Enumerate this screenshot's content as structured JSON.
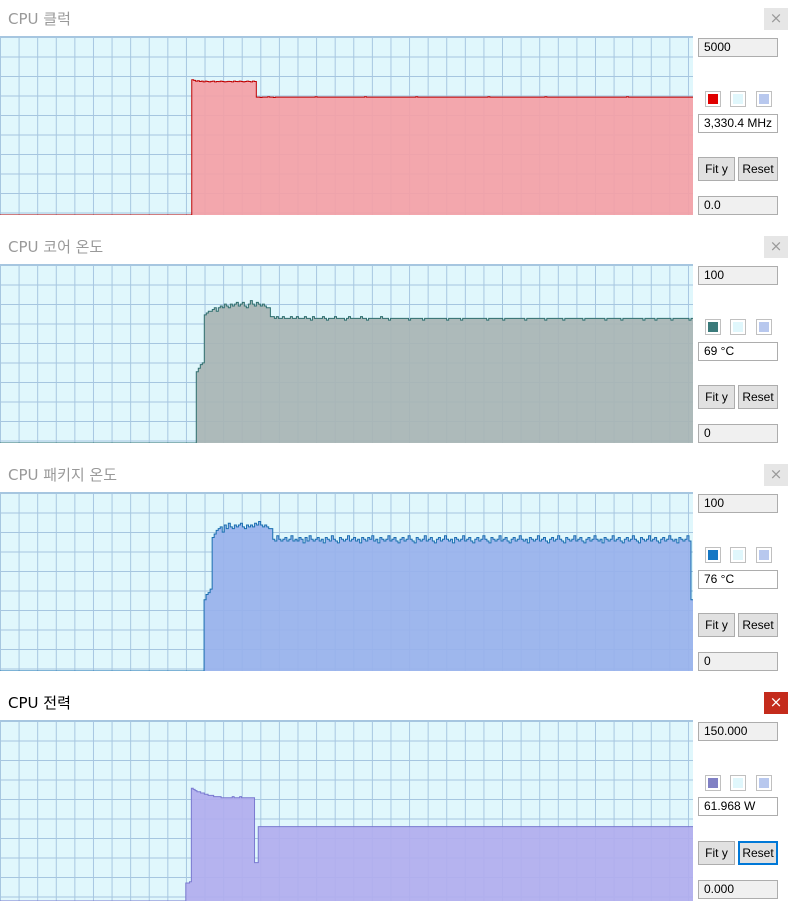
{
  "panels": [
    {
      "id": "cpu-clock",
      "title": "CPU 클럭",
      "active": false,
      "close_label": "×",
      "max": "5000",
      "current": "3,330.4 MHz",
      "min": "0.0",
      "fit_label": "Fit y",
      "reset_label": "Reset",
      "colors": {
        "line": "#c00000",
        "fill": "#f4a0a6",
        "swatch": "#e00000",
        "swatch3": "#b8c8ee"
      },
      "y_max": 5000,
      "series": [
        0,
        0,
        0,
        0,
        0,
        0,
        0,
        0,
        0,
        0,
        0,
        0,
        0,
        0,
        0,
        0,
        0,
        0,
        0,
        0,
        0,
        0,
        0,
        0,
        0,
        0,
        0,
        0,
        0,
        0,
        0,
        0,
        0,
        0,
        0,
        0,
        0,
        0,
        0,
        0,
        0,
        0,
        0,
        0,
        0,
        0,
        0,
        0,
        0,
        0,
        0,
        0,
        0,
        0,
        0,
        0,
        0,
        0,
        0,
        0,
        0,
        0,
        0,
        0,
        0,
        0,
        0,
        0,
        0,
        0,
        0,
        0,
        0,
        0,
        0,
        0,
        0,
        0,
        0,
        0,
        0,
        0,
        0,
        0,
        0,
        0,
        0,
        0,
        0,
        0,
        0,
        0,
        0,
        0,
        0,
        0,
        0,
        0,
        0,
        0,
        0,
        3800,
        3780,
        3760,
        3770,
        3750,
        3760,
        3740,
        3760,
        3750,
        3740,
        3755,
        3760,
        3740,
        3750,
        3745,
        3760,
        3750,
        3740,
        3745,
        3755,
        3750,
        3740,
        3760,
        3750,
        3745,
        3760,
        3750,
        3740,
        3750,
        3760,
        3750,
        3740,
        3760,
        3750,
        3310,
        3310,
        3300,
        3310,
        3310,
        3310,
        3320,
        3310,
        3310,
        3300,
        3310,
        3310,
        3310,
        3310,
        3310,
        3310,
        3310,
        3310,
        3310,
        3310,
        3310,
        3310,
        3310,
        3310,
        3310,
        3310,
        3310,
        3310,
        3310,
        3310,
        3310,
        3320,
        3310,
        3310,
        3310,
        3310,
        3310,
        3310,
        3310,
        3310,
        3310,
        3310,
        3310,
        3310,
        3310,
        3310,
        3310,
        3310,
        3310,
        3310,
        3310,
        3310,
        3310,
        3310,
        3310,
        3310,
        3310,
        3320,
        3310,
        3310,
        3310,
        3310,
        3310,
        3310,
        3310,
        3310,
        3310,
        3310,
        3310,
        3310,
        3310,
        3310,
        3310,
        3310,
        3310,
        3310,
        3310,
        3310,
        3310,
        3310,
        3310,
        3310,
        3310,
        3310,
        3320,
        3310,
        3310,
        3310,
        3310,
        3310,
        3310,
        3310,
        3310,
        3310,
        3310,
        3310,
        3310,
        3310,
        3310,
        3310,
        3310,
        3310,
        3310,
        3310,
        3310,
        3310,
        3310,
        3310,
        3310,
        3310,
        3310,
        3310,
        3310,
        3310,
        3310,
        3310,
        3310,
        3310,
        3310,
        3310,
        3310,
        3310,
        3320,
        3310,
        3310,
        3310,
        3310,
        3310,
        3310,
        3310,
        3310,
        3310,
        3310,
        3310,
        3310,
        3310,
        3310,
        3310,
        3310,
        3310,
        3310,
        3310,
        3310,
        3310,
        3310,
        3310,
        3310,
        3310,
        3310,
        3310,
        3310,
        3310,
        3320,
        3310,
        3310,
        3310,
        3310,
        3310,
        3310,
        3310,
        3310,
        3310,
        3310,
        3310,
        3310,
        3310,
        3310,
        3310,
        3310,
        3310,
        3310,
        3310,
        3310,
        3310,
        3310,
        3310,
        3310,
        3310,
        3310,
        3310,
        3310,
        3310,
        3310,
        3310,
        3310,
        3310,
        3310,
        3310,
        3310,
        3310,
        3310,
        3310,
        3310,
        3310,
        3310,
        3320,
        3310,
        3310,
        3310,
        3310,
        3310,
        3310,
        3310,
        3310,
        3310,
        3310,
        3310,
        3310,
        3310,
        3310,
        3310,
        3310,
        3310,
        3310,
        3310,
        3310,
        3310,
        3310,
        3310,
        3310,
        3310,
        3310,
        3310,
        3310,
        3310,
        3310,
        3310,
        3310,
        3310,
        3310
      ]
    },
    {
      "id": "cpu-core-temp",
      "title": "CPU 코어 온도",
      "active": false,
      "close_label": "×",
      "max": "100",
      "current": "69 °C",
      "min": "0",
      "fit_label": "Fit y",
      "reset_label": "Reset",
      "colors": {
        "line": "#2f6f6f",
        "fill": "#a8b4b4",
        "swatch": "#3a7a7a",
        "swatch3": "#b8c8ee"
      },
      "y_max": 100,
      "series": [
        0,
        0,
        0,
        0,
        0,
        0,
        0,
        0,
        0,
        0,
        0,
        0,
        0,
        0,
        0,
        0,
        0,
        0,
        0,
        0,
        0,
        0,
        0,
        0,
        0,
        0,
        0,
        0,
        0,
        0,
        0,
        0,
        0,
        0,
        0,
        0,
        0,
        0,
        0,
        0,
        0,
        0,
        0,
        0,
        0,
        0,
        0,
        0,
        0,
        0,
        0,
        0,
        0,
        0,
        0,
        0,
        0,
        0,
        0,
        0,
        0,
        0,
        0,
        0,
        0,
        0,
        0,
        0,
        0,
        0,
        0,
        0,
        0,
        0,
        0,
        0,
        0,
        0,
        0,
        0,
        0,
        0,
        0,
        0,
        0,
        0,
        0,
        0,
        0,
        0,
        0,
        0,
        0,
        0,
        0,
        0,
        0,
        0,
        40,
        42,
        44,
        45,
        72,
        73,
        74,
        74,
        75,
        76,
        74,
        76,
        77,
        76,
        78,
        77,
        76,
        78,
        77,
        78,
        79,
        77,
        78,
        79,
        77,
        76,
        78,
        80,
        78,
        77,
        79,
        78,
        77,
        78,
        77,
        76,
        76,
        71,
        71,
        70,
        71,
        70,
        70,
        71,
        70,
        70,
        70,
        71,
        70,
        70,
        71,
        70,
        70,
        70,
        71,
        70,
        70,
        69,
        71,
        70,
        70,
        70,
        70,
        71,
        70,
        69,
        70,
        70,
        70,
        71,
        70,
        70,
        70,
        70,
        69,
        70,
        71,
        70,
        70,
        70,
        70,
        70,
        71,
        70,
        70,
        69,
        70,
        70,
        70,
        70,
        70,
        70,
        71,
        70,
        70,
        70,
        69,
        70,
        70,
        70,
        70,
        70,
        70,
        70,
        70,
        70,
        69,
        70,
        70,
        70,
        70,
        70,
        70,
        69,
        70,
        70,
        70,
        70,
        70,
        70,
        70,
        70,
        70,
        70,
        70,
        69,
        70,
        70,
        70,
        70,
        70,
        70,
        69,
        70,
        70,
        70,
        70,
        70,
        70,
        70,
        70,
        70,
        70,
        70,
        70,
        69,
        70,
        70,
        70,
        70,
        70,
        70,
        70,
        69,
        70,
        70,
        70,
        70,
        70,
        70,
        70,
        70,
        70,
        70,
        69,
        70,
        70,
        70,
        70,
        70,
        70,
        70,
        70,
        70,
        69,
        70,
        70,
        70,
        70,
        70,
        70,
        70,
        70,
        69,
        70,
        70,
        70,
        70,
        70,
        70,
        70,
        70,
        70,
        69,
        70,
        70,
        70,
        70,
        70,
        70,
        70,
        70,
        70,
        70,
        69,
        70,
        70,
        70,
        70,
        70,
        70,
        70,
        69,
        70,
        70,
        70,
        70,
        70,
        70,
        70,
        70,
        70,
        70,
        69,
        70,
        70,
        70,
        70,
        70,
        69,
        70,
        70,
        70,
        70,
        70,
        70,
        70,
        69,
        70,
        70,
        70,
        70,
        70,
        70,
        70,
        70,
        69,
        70
      ]
    },
    {
      "id": "cpu-package-temp",
      "title": "CPU 패키지 온도",
      "active": false,
      "close_label": "×",
      "max": "100",
      "current": "76 °C",
      "min": "0",
      "fit_label": "Fit y",
      "reset_label": "Reset",
      "colors": {
        "line": "#1a6fb0",
        "fill": "#98b1ec",
        "swatch": "#1577c4",
        "swatch3": "#b8c8ee"
      },
      "y_max": 100,
      "series": [
        0,
        0,
        0,
        0,
        0,
        0,
        0,
        0,
        0,
        0,
        0,
        0,
        0,
        0,
        0,
        0,
        0,
        0,
        0,
        0,
        0,
        0,
        0,
        0,
        0,
        0,
        0,
        0,
        0,
        0,
        0,
        0,
        0,
        0,
        0,
        0,
        0,
        0,
        0,
        0,
        0,
        0,
        0,
        0,
        0,
        0,
        0,
        0,
        0,
        0,
        0,
        0,
        0,
        0,
        0,
        0,
        0,
        0,
        0,
        0,
        0,
        0,
        0,
        0,
        0,
        0,
        0,
        0,
        0,
        0,
        0,
        0,
        0,
        0,
        0,
        0,
        0,
        0,
        0,
        0,
        0,
        0,
        0,
        0,
        0,
        0,
        0,
        0,
        0,
        0,
        0,
        0,
        0,
        0,
        0,
        0,
        0,
        0,
        0,
        0,
        0,
        40,
        43,
        44,
        46,
        75,
        77,
        79,
        80,
        81,
        78,
        82,
        80,
        83,
        81,
        80,
        82,
        81,
        82,
        83,
        81,
        80,
        82,
        81,
        82,
        81,
        83,
        82,
        84,
        82,
        81,
        82,
        81,
        80,
        80,
        74,
        73,
        76,
        74,
        73,
        74,
        75,
        73,
        74,
        76,
        73,
        74,
        73,
        75,
        74,
        72,
        75,
        73,
        76,
        74,
        73,
        74,
        75,
        73,
        74,
        72,
        75,
        74,
        73,
        76,
        74,
        73,
        72,
        75,
        74,
        73,
        74,
        76,
        73,
        74,
        75,
        73,
        74,
        72,
        75,
        74,
        73,
        75,
        74,
        76,
        73,
        74,
        72,
        75,
        74,
        73,
        74,
        76,
        73,
        74,
        75,
        73,
        72,
        74,
        75,
        73,
        74,
        76,
        74,
        73,
        72,
        75,
        74,
        73,
        74,
        76,
        73,
        74,
        75,
        73,
        72,
        74,
        75,
        73,
        74,
        76,
        74,
        73,
        74,
        72,
        75,
        74,
        73,
        74,
        76,
        73,
        74,
        75,
        73,
        72,
        74,
        75,
        73,
        74,
        76,
        74,
        73,
        72,
        75,
        74,
        73,
        74,
        76,
        73,
        74,
        75,
        73,
        72,
        74,
        75,
        73,
        74,
        76,
        74,
        73,
        74,
        72,
        75,
        74,
        73,
        74,
        76,
        73,
        74,
        75,
        73,
        72,
        74,
        75,
        73,
        74,
        76,
        74,
        73,
        72,
        75,
        74,
        73,
        74,
        76,
        73,
        74,
        75,
        73,
        72,
        74,
        75,
        73,
        74,
        76,
        74,
        73,
        74,
        72,
        75,
        74,
        73,
        74,
        76,
        73,
        74,
        75,
        73,
        72,
        74,
        75,
        73,
        74,
        76,
        74,
        73,
        72,
        75,
        74,
        73,
        74,
        76,
        73,
        74,
        75,
        73,
        72,
        74,
        75,
        73,
        74,
        76,
        74,
        73,
        74,
        72,
        75,
        74,
        73,
        74,
        76,
        73,
        40
      ]
    },
    {
      "id": "cpu-power",
      "title": "CPU 전력",
      "active": true,
      "close_label": "×",
      "max": "150.000",
      "current": "61.968 W",
      "min": "0.000",
      "fit_label": "Fit y",
      "reset_label": "Reset",
      "colors": {
        "line": "#7a7ad0",
        "fill": "#b1acee",
        "swatch": "#8080c4",
        "swatch3": "#b8c8ee"
      },
      "y_max": 150,
      "series": [
        0,
        0,
        0,
        0,
        0,
        0,
        0,
        0,
        0,
        0,
        0,
        0,
        0,
        0,
        0,
        0,
        0,
        0,
        0,
        0,
        0,
        0,
        0,
        0,
        0,
        0,
        0,
        0,
        0,
        0,
        0,
        0,
        0,
        0,
        0,
        0,
        0,
        0,
        0,
        0,
        0,
        0,
        0,
        0,
        0,
        0,
        0,
        0,
        0,
        0,
        0,
        0,
        0,
        0,
        0,
        0,
        0,
        0,
        0,
        0,
        0,
        0,
        0,
        0,
        0,
        0,
        0,
        0,
        0,
        0,
        0,
        0,
        0,
        0,
        0,
        0,
        0,
        0,
        0,
        0,
        0,
        0,
        0,
        0,
        0,
        0,
        0,
        0,
        0,
        0,
        0,
        0,
        0,
        0,
        0,
        0,
        0,
        0,
        0,
        0,
        15,
        15,
        16,
        94,
        93,
        92,
        91,
        91,
        90,
        90,
        89,
        89,
        88,
        88,
        88,
        87,
        87,
        87,
        87,
        86,
        86,
        86,
        86,
        86,
        86,
        87,
        86,
        86,
        86,
        87,
        86,
        86,
        86,
        86,
        86,
        86,
        86,
        32,
        32,
        62,
        62,
        62,
        62,
        62,
        62,
        62,
        62,
        62,
        62,
        62,
        62,
        62,
        62,
        62,
        62,
        62,
        62,
        62,
        62,
        62,
        62,
        62,
        62,
        62,
        62,
        62,
        62,
        62,
        62,
        62,
        62,
        62,
        62,
        62,
        62,
        62,
        62,
        62,
        62,
        62,
        62,
        62,
        62,
        62,
        62,
        62,
        62,
        62,
        62,
        62,
        62,
        62,
        62,
        62,
        62,
        62,
        62,
        62,
        62,
        62,
        62,
        62,
        62,
        62,
        62,
        62,
        62,
        62,
        62,
        62,
        62,
        62,
        62,
        62,
        62,
        62,
        62,
        62,
        62,
        62,
        62,
        62,
        62,
        62,
        62,
        62,
        62,
        62,
        62,
        62,
        62,
        62,
        62,
        62,
        62,
        62,
        62,
        62,
        62,
        62,
        62,
        62,
        62,
        62,
        62,
        62,
        62,
        62,
        62,
        62,
        62,
        62,
        62,
        62,
        62,
        62,
        62,
        62,
        62,
        62,
        62,
        62,
        62,
        62,
        62,
        62,
        62,
        62,
        62,
        62,
        62,
        62,
        62,
        62,
        62,
        62,
        62,
        62,
        62,
        62,
        62,
        62,
        62,
        62,
        62,
        62,
        62,
        62,
        62,
        62,
        62,
        62,
        62,
        62,
        62,
        62,
        62,
        62,
        62,
        62,
        62,
        62,
        62,
        62,
        62,
        62,
        62,
        62,
        62,
        62,
        62,
        62,
        62,
        62,
        62,
        62,
        62,
        62,
        62,
        62,
        62,
        62,
        62,
        62,
        62,
        62,
        62,
        62,
        62,
        62,
        62,
        62,
        62,
        62,
        62,
        62,
        62,
        62,
        62,
        62,
        62,
        62,
        62,
        62,
        62,
        62,
        62,
        62,
        62,
        62,
        62,
        62,
        62,
        62,
        62,
        62,
        62,
        62,
        62,
        62,
        62,
        62,
        62,
        62,
        62,
        62,
        62,
        62,
        62,
        62,
        62,
        62,
        62
      ]
    }
  ]
}
